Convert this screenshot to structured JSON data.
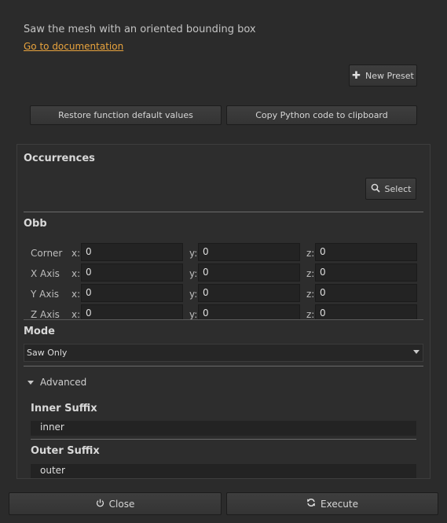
{
  "description": "Saw the mesh with an oriented bounding box",
  "doc_link": "Go to documentation",
  "buttons": {
    "new_preset": "New Preset",
    "restore_defaults": "Restore function default values",
    "copy_python": "Copy Python code to clipboard",
    "select": "Select",
    "close": "Close",
    "execute": "Execute"
  },
  "occurrences": {
    "title": "Occurrences"
  },
  "obb": {
    "title": "Obb",
    "axis_labels": {
      "x": "x:",
      "y": "y:",
      "z": "z:"
    },
    "rows": [
      {
        "label": "Corner",
        "x": "0",
        "y": "0",
        "z": "0"
      },
      {
        "label": "X Axis",
        "x": "0",
        "y": "0",
        "z": "0"
      },
      {
        "label": "Y Axis",
        "x": "0",
        "y": "0",
        "z": "0"
      },
      {
        "label": "Z Axis",
        "x": "0",
        "y": "0",
        "z": "0"
      }
    ]
  },
  "mode": {
    "title": "Mode",
    "selected": "Saw Only"
  },
  "advanced": {
    "label": "Advanced",
    "inner_suffix": {
      "title": "Inner Suffix",
      "value": "inner"
    },
    "outer_suffix": {
      "title": "Outer Suffix",
      "value": "outer"
    }
  },
  "icons": {
    "new_preset": "plus-icon",
    "select": "search-icon",
    "close": "power-icon",
    "execute": "refresh-icon"
  }
}
